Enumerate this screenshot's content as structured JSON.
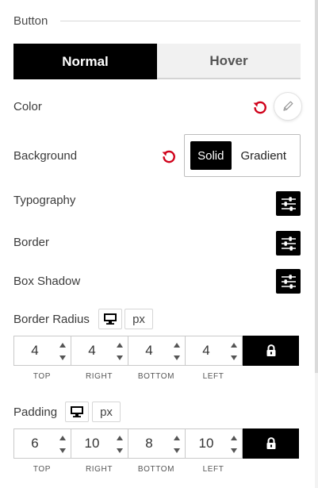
{
  "section": {
    "title": "Button"
  },
  "tabs": [
    {
      "label": "Normal",
      "active": true
    },
    {
      "label": "Hover",
      "active": false
    }
  ],
  "rows": {
    "color": {
      "label": "Color"
    },
    "background": {
      "label": "Background",
      "options": [
        "Solid",
        "Gradient"
      ],
      "selected": "Solid"
    },
    "typography": {
      "label": "Typography"
    },
    "border": {
      "label": "Border"
    },
    "box_shadow": {
      "label": "Box Shadow"
    }
  },
  "border_radius": {
    "label": "Border Radius",
    "unit": "px",
    "values": {
      "top": "4",
      "right": "4",
      "bottom": "4",
      "left": "4"
    },
    "labels": {
      "top": "TOP",
      "right": "RIGHT",
      "bottom": "BOTTOM",
      "left": "LEFT"
    }
  },
  "padding": {
    "label": "Padding",
    "unit": "px",
    "values": {
      "top": "6",
      "right": "10",
      "bottom": "8",
      "left": "10"
    },
    "labels": {
      "top": "TOP",
      "right": "RIGHT",
      "bottom": "BOTTOM",
      "left": "LEFT"
    }
  },
  "icons": {
    "reset": "reset-icon",
    "color_picker": "pencil-icon",
    "settings": "sliders-icon",
    "device": "desktop-icon",
    "lock": "lock-icon",
    "spin_up": "caret-up-icon",
    "spin_down": "caret-down-icon"
  },
  "colors": {
    "accent": "#000000",
    "reset": "#d0021b",
    "tab_inactive_bg": "#f1f1f1",
    "border": "#c9c9c9"
  }
}
